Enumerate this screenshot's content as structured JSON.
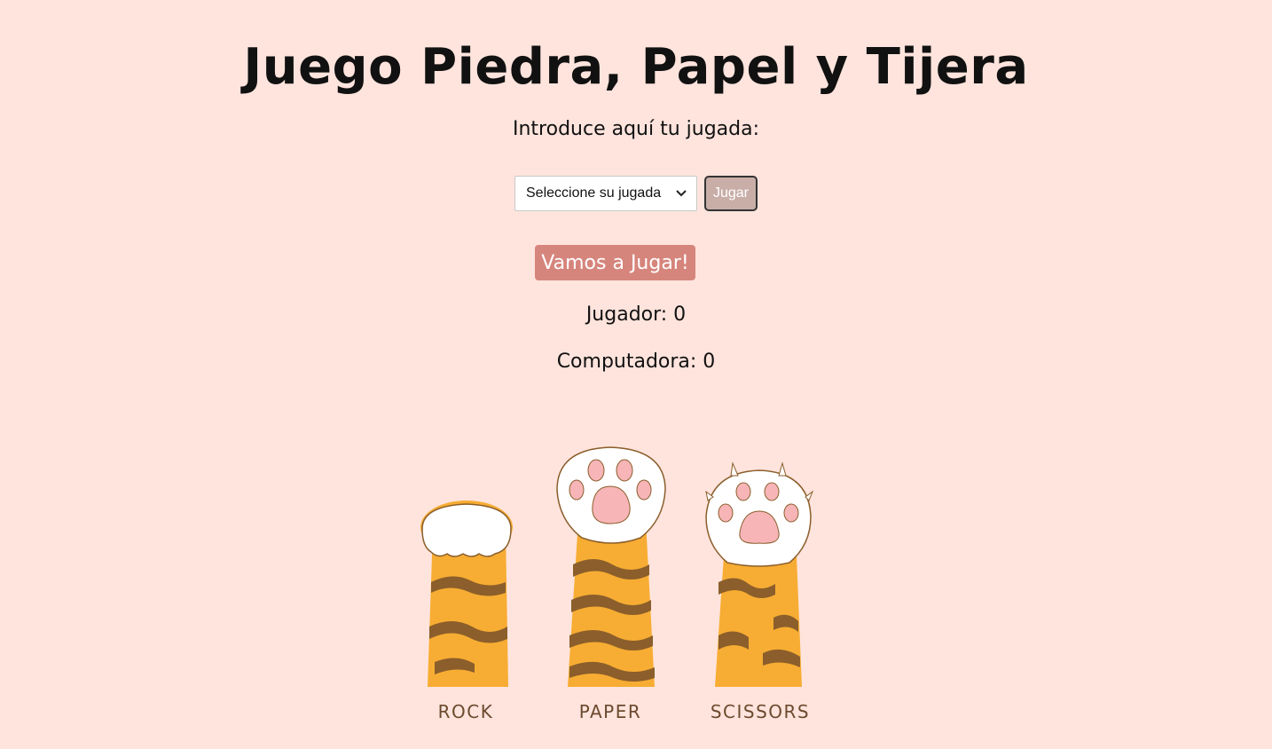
{
  "header": {
    "title": "Juego Piedra, Papel y Tijera",
    "prompt": "Introduce aquí tu jugada:"
  },
  "controls": {
    "select_value": "Seleccione su jugada",
    "play_button": "Jugar"
  },
  "start_button": "Vamos a Jugar!",
  "scores": {
    "player": "Jugador: 0",
    "computer": "Computadora: 0"
  },
  "paws": {
    "rock_label": "ROCK",
    "paper_label": "PAPER",
    "scissors_label": "SCISSORS"
  },
  "colors": {
    "background": "#ffe4dd",
    "start_button": "#d6857c",
    "play_button": "#c9aea8",
    "fur_orange": "#f7ad33",
    "fur_stripe": "#8b5e2b",
    "paw_pad": "#f7b5b8"
  }
}
